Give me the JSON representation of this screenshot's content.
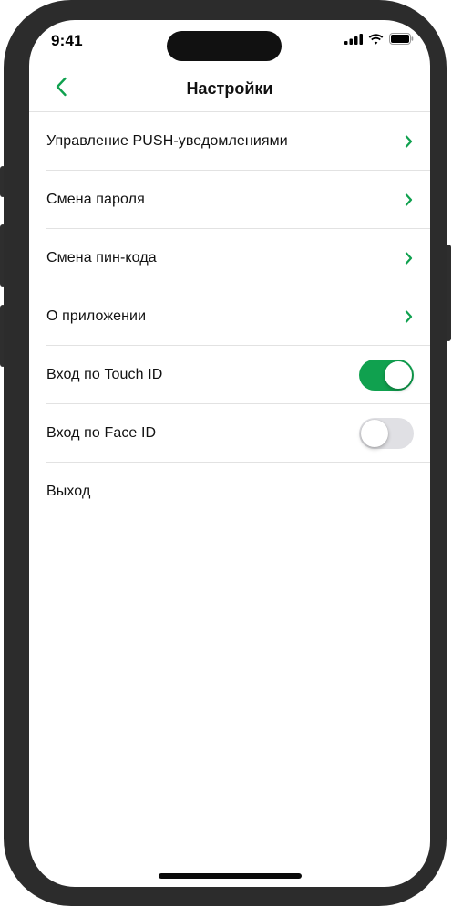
{
  "status_bar": {
    "time": "9:41"
  },
  "header": {
    "title": "Настройки",
    "back_icon": "chevron-left-icon"
  },
  "settings": {
    "items": [
      {
        "label": "Управление PUSH-уведомлениями",
        "control": "chevron"
      },
      {
        "label": "Смена пароля",
        "control": "chevron"
      },
      {
        "label": "Смена пин-кода",
        "control": "chevron"
      },
      {
        "label": "О приложении",
        "control": "chevron"
      },
      {
        "label": "Вход по Touch ID",
        "control": "toggle",
        "enabled": true
      },
      {
        "label": "Вход по Face ID",
        "control": "toggle",
        "enabled": false
      },
      {
        "label": "Выход",
        "control": "none"
      }
    ]
  },
  "colors": {
    "accent": "#10a14f",
    "toggle_off": "#e0e0e4",
    "frame": "#2c2c2c"
  }
}
